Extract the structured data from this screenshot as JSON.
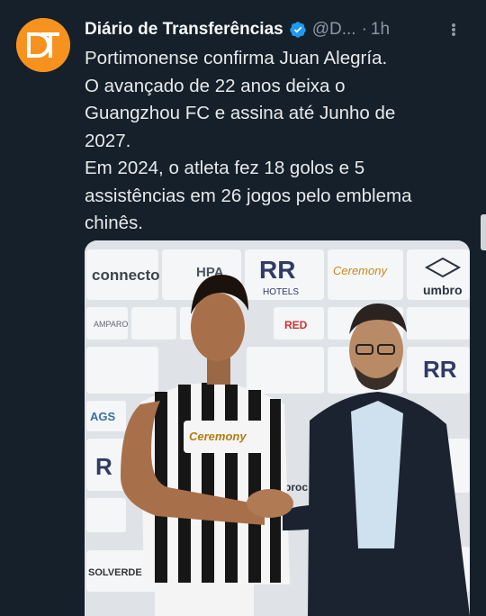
{
  "tweet": {
    "author_name": "Diário de Transferências",
    "handle": "@D...",
    "separator": "·",
    "time": "1h",
    "avatar_text": "DT",
    "lines": [
      "Portimonense confirma Juan Alegría.",
      "O avançado de 22 anos deixa o",
      "Guangzhou FC e assina até Junho de",
      "2027.",
      "Em 2024, o atleta fez 18 golos e 5",
      "assistências em 26 jogos pelo emblema",
      "chinês."
    ]
  },
  "media": {
    "backdrop_brands": [
      "connecto",
      "HPA",
      "RR",
      "HOTELS",
      "Ceremony",
      "umbro",
      "AMPARO",
      "RED",
      "AGS",
      "SOLVERDE",
      "proc"
    ],
    "shirt_sponsor": "Ceremony"
  },
  "colors": {
    "background": "#15202b",
    "text": "#e7e9ea",
    "secondary": "#8b98a5",
    "verified": "#1d9bf0",
    "avatar": "#f7921e"
  }
}
